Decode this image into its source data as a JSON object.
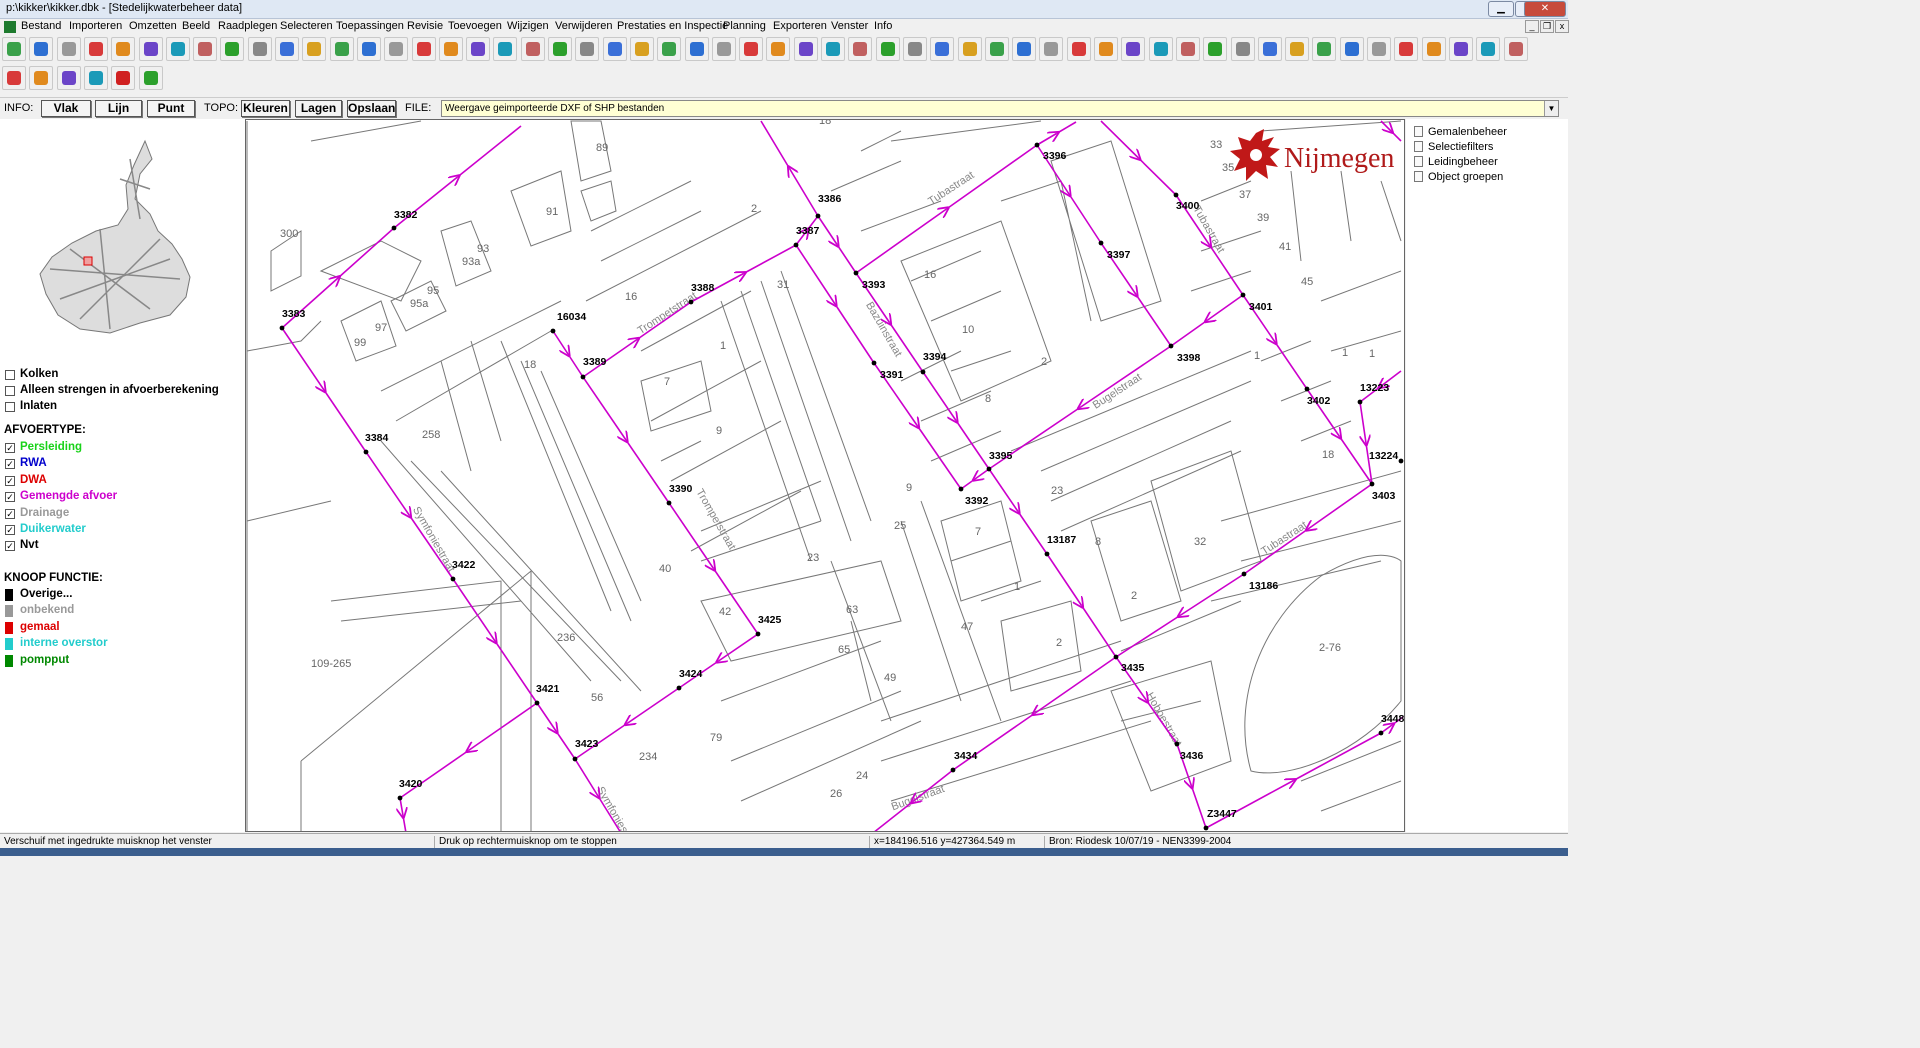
{
  "window": {
    "title": "p:\\kikker\\kikker.dbk - [Stedelijkwaterbeheer data]",
    "buttons": [
      "▁",
      "❐",
      "✕"
    ]
  },
  "menu": [
    "Bestand",
    "Importeren",
    "Omzetten",
    "Beeld",
    "Raadplegen",
    "Selecteren",
    "Toepassingen",
    "Revisie",
    "Toevoegen",
    "Wijzigen",
    "Verwijderen",
    "Prestaties en Inspectie",
    "Planning",
    "Exporteren",
    "Venster",
    "Info"
  ],
  "infobar": {
    "info_label": "INFO:",
    "vlak": "Vlak",
    "lijn": "Lijn",
    "punt": "Punt",
    "topo_label": "TOPO:",
    "kleuren": "Kleuren",
    "lagen": "Lagen",
    "opslaan": "Opslaan",
    "file_label": "FILE:",
    "file_value": "Weergave geimporteerde DXF of SHP bestanden"
  },
  "left": {
    "filters": [
      {
        "label": "Kolken",
        "checked": false
      },
      {
        "label": "Alleen strengen in afvoerberekening",
        "checked": false
      },
      {
        "label": "Inlaten",
        "checked": false
      }
    ],
    "afvoer_title": "AFVOERTYPE:",
    "afvoer": [
      {
        "label": "Persleiding",
        "color": "#19d219",
        "checked": true
      },
      {
        "label": "RWA",
        "color": "#0000cc",
        "checked": true
      },
      {
        "label": "DWA",
        "color": "#dd0000",
        "checked": true
      },
      {
        "label": "Gemengde afvoer",
        "color": "#cc00cc",
        "checked": true
      },
      {
        "label": "Drainage",
        "color": "#999999",
        "checked": true
      },
      {
        "label": "Duikerwater",
        "color": "#22cccc",
        "checked": true
      },
      {
        "label": "Nvt",
        "color": "#000000",
        "checked": true
      }
    ],
    "knoop_title": "KNOOP FUNCTIE:",
    "knoop": [
      {
        "label": "Overige...",
        "color": "#000000"
      },
      {
        "label": "onbekend",
        "color": "#999999"
      },
      {
        "label": "gemaal",
        "color": "#dd0000"
      },
      {
        "label": "interne overstor",
        "color": "#22cccc"
      },
      {
        "label": "pompput",
        "color": "#008800"
      }
    ]
  },
  "right": {
    "items": [
      "Gemalenbeheer",
      "Selectiefilters",
      "Leidingbeheer",
      "Object groepen"
    ],
    "logo": "Nijmegen"
  },
  "map": {
    "nodes": [
      "3382",
      "3383",
      "3384",
      "3422",
      "3421",
      "3420",
      "3423",
      "3424",
      "3425",
      "3390",
      "3389",
      "16034",
      "3388",
      "3387",
      "3386",
      "3396",
      "3397",
      "3393",
      "3391",
      "3394",
      "3398",
      "3401",
      "3400",
      "3402",
      "3403",
      "13224",
      "13223",
      "3395",
      "3392",
      "13187",
      "13186",
      "3435",
      "3436",
      "3434",
      "3448",
      "Z3447"
    ],
    "house_numbers": [
      "89",
      "91",
      "2",
      "300",
      "93",
      "93a",
      "95",
      "95a",
      "97",
      "99",
      "16",
      "18",
      "1",
      "7",
      "31",
      "9",
      "40",
      "42",
      "236",
      "56",
      "258",
      "109-265",
      "79",
      "234",
      "24",
      "26",
      "63",
      "65",
      "49",
      "47",
      "25",
      "23",
      "7",
      "1",
      "2",
      "9",
      "16",
      "10",
      "2",
      "8",
      "1",
      "23",
      "8",
      "2",
      "32",
      "18",
      "2-76",
      "1",
      "45",
      "41",
      "39",
      "37",
      "35",
      "33",
      "1",
      "18"
    ],
    "streets": [
      "Tubastraat",
      "Trompetstraat",
      "Bazuinstraat",
      "Bugelstraat",
      "Trompetstraat",
      "Symfoniestraat",
      "Hoboestraat",
      "Symfoniestraat",
      "Bugelstraat",
      "Tubastraat",
      "Tubastraat"
    ]
  },
  "status": {
    "hint": "Verschuif met ingedrukte muisknop het venster",
    "hint2": "Druk op rechtermuisknop om te stoppen",
    "coords": "x=184196.516 y=427364.549 m",
    "source": "Bron: Riodesk 10/07/19 - NEN3399-2004"
  },
  "colors": {
    "sewer": "#cc00cc",
    "accent": "#ffffd4"
  }
}
